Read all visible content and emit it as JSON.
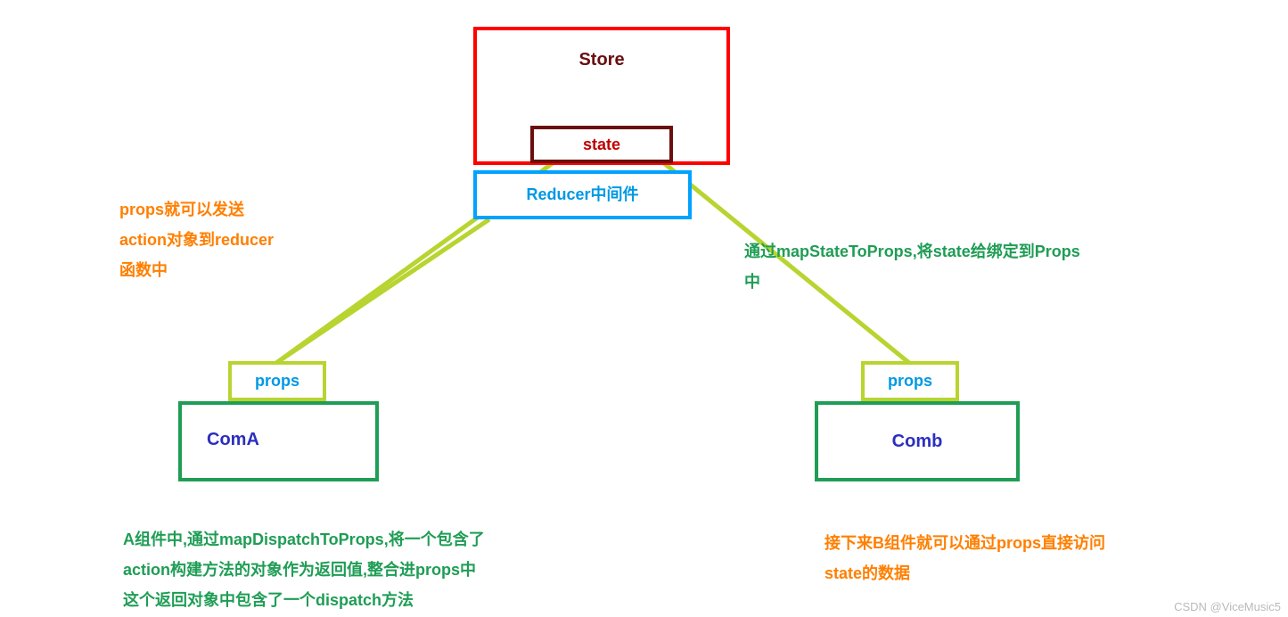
{
  "store": {
    "title": "Store",
    "state_label": "state"
  },
  "reducer": {
    "label": "Reducer中间件"
  },
  "comA": {
    "label": "ComA",
    "props_label": "props"
  },
  "comB": {
    "label": "Comb",
    "props_label": "props"
  },
  "annotations": {
    "left_orange_line1": "props就可以发送",
    "left_orange_line2": "action对象到reducer",
    "left_orange_line3": "函数中",
    "right_green_line1": "通过mapStateToProps,将state给绑定到Props",
    "right_green_line2": "中",
    "bottom_green_line1": "A组件中,通过mapDispatchToProps,将一个包含了",
    "bottom_green_line2": "action构建方法的对象作为返回值,整合进props中",
    "bottom_green_line3": "这个返回对象中包含了一个dispatch方法",
    "bottom_orange_line1": "接下来B组件就可以通过props直接访问",
    "bottom_orange_line2": "state的数据"
  },
  "watermark": "CSDN @ViceMusic5",
  "chart_data": {
    "type": "diagram",
    "title": "Redux data flow between Store, Reducer middleware and components",
    "nodes": [
      {
        "id": "store",
        "label": "Store",
        "color": "#ff0000"
      },
      {
        "id": "state",
        "label": "state",
        "parent": "store",
        "color": "#6b0e0e"
      },
      {
        "id": "reducer",
        "label": "Reducer中间件",
        "color": "#00a2ff"
      },
      {
        "id": "propsA",
        "label": "props",
        "parent": "comA",
        "color": "#b8d430"
      },
      {
        "id": "comA",
        "label": "ComA",
        "color": "#1f9d55"
      },
      {
        "id": "propsB",
        "label": "props",
        "parent": "comB",
        "color": "#b8d430"
      },
      {
        "id": "comB",
        "label": "Comb",
        "color": "#1f9d55"
      }
    ],
    "edges": [
      {
        "from": "state",
        "to": "propsA",
        "color": "#b8d430"
      },
      {
        "from": "state",
        "to": "propsB",
        "color": "#b8d430"
      },
      {
        "from": "reducer",
        "to": "propsA",
        "color": "#b8d430"
      }
    ],
    "annotations": [
      {
        "anchor": "edge:reducer->propsA",
        "text": "props就可以发送action对象到reducer函数中",
        "color": "#ff7f00"
      },
      {
        "anchor": "edge:state->propsB",
        "text": "通过mapStateToProps,将state给绑定到Props中",
        "color": "#1f9d55"
      },
      {
        "anchor": "comA",
        "text": "A组件中,通过mapDispatchToProps,将一个包含了action构建方法的对象作为返回值,整合进props中 这个返回对象中包含了一个dispatch方法",
        "color": "#1f9d55"
      },
      {
        "anchor": "comB",
        "text": "接下来B组件就可以通过props直接访问state的数据",
        "color": "#ff7f00"
      }
    ]
  }
}
